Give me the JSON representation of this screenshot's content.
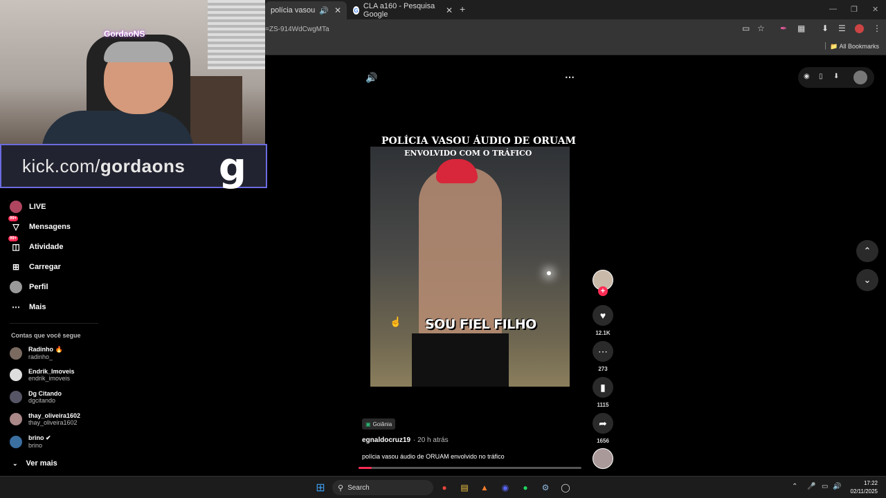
{
  "browser": {
    "tabs": [
      {
        "label": "polícia vasou áudio de",
        "active": true
      },
      {
        "label": "CLA a160 - Pesquisa Google",
        "active": false
      }
    ],
    "url": "=ZS-914WdCwgMTa",
    "all_bookmarks": "All Bookmarks"
  },
  "stream": {
    "streamer_name": "GordaoNS",
    "kick_url_prefix": "kick.com/",
    "kick_url_name": "gordaons",
    "kick_logo": "g"
  },
  "sidebar": {
    "items": [
      {
        "label": "LIVE",
        "badge": ""
      },
      {
        "label": "Mensagens",
        "badge": "99+"
      },
      {
        "label": "Atividade",
        "badge": "99+"
      },
      {
        "label": "Carregar",
        "badge": ""
      },
      {
        "label": "Perfil",
        "badge": ""
      },
      {
        "label": "Mais",
        "badge": ""
      }
    ],
    "following_title": "Contas que você segue",
    "accounts": [
      {
        "name": "Radinho 🔥",
        "handle": "radinho_"
      },
      {
        "name": "Endrik_Imoveis",
        "handle": "endrik_imoveis"
      },
      {
        "name": "Dg Citando",
        "handle": "dgcitando"
      },
      {
        "name": "thay_oliveira1602",
        "handle": "thay_oliveira1602"
      },
      {
        "name": "brino ✔",
        "handle": "brino"
      }
    ],
    "see_more": "Ver mais"
  },
  "video": {
    "headline": "POLÍCIA VASOU ÁUDIO DE ORUAM",
    "subline": "ENVOLVIDO COM O TRÁFICO",
    "caption": "SOU FIEL FILHO",
    "location": "Goiânia",
    "author": "egnaldocruz19",
    "time": "· 20 h atrás",
    "description": "polícia vasou áudio de ORUAM envolvido no tráfico",
    "progress": 0.06
  },
  "actions": {
    "likes": "12.1K",
    "comments": "273",
    "saves": "1115",
    "shares": "1656"
  },
  "taskbar": {
    "search": "Search",
    "time": "17:22",
    "date": "02/11/2025"
  },
  "colors": {
    "accent": "#fe2c55",
    "kick_border": "#6b6be0"
  }
}
